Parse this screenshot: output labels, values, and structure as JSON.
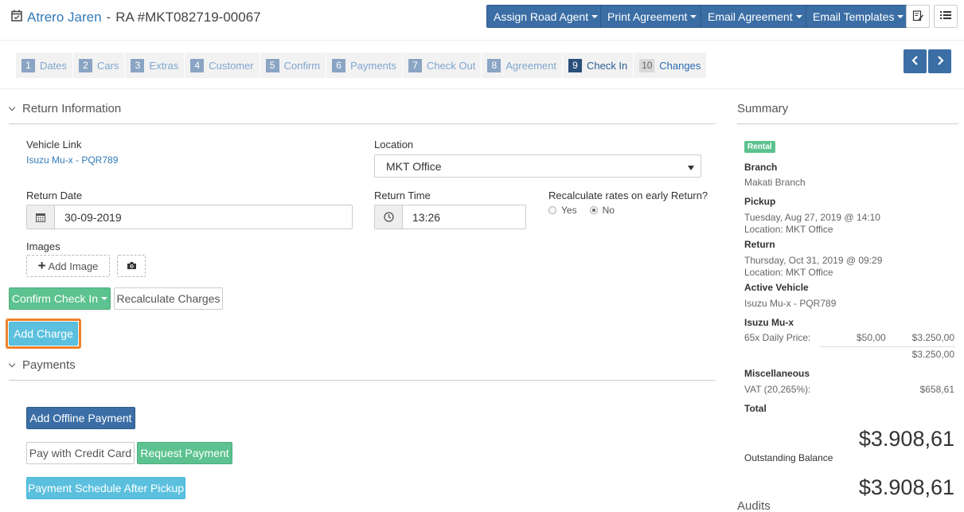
{
  "header": {
    "customer_name": "Atrero Jaren",
    "separator": "-",
    "ra_number": "RA #MKT082719-00067",
    "buttons": [
      "Assign Road Agent",
      "Print Agreement",
      "Email Agreement",
      "Email Templates"
    ]
  },
  "steps": [
    {
      "num": "1",
      "label": "Dates"
    },
    {
      "num": "2",
      "label": "Cars"
    },
    {
      "num": "3",
      "label": "Extras"
    },
    {
      "num": "4",
      "label": "Customer"
    },
    {
      "num": "5",
      "label": "Confirm"
    },
    {
      "num": "6",
      "label": "Payments"
    },
    {
      "num": "7",
      "label": "Check Out"
    },
    {
      "num": "8",
      "label": "Agreement"
    },
    {
      "num": "9",
      "label": "Check In"
    },
    {
      "num": "10",
      "label": "Changes"
    }
  ],
  "return_info": {
    "title": "Return Information",
    "vehicle_link_label": "Vehicle Link",
    "vehicle_link": "Isuzu Mu-x - PQR789",
    "location_label": "Location",
    "location_value": "MKT Office",
    "return_date_label": "Return Date",
    "return_date": "30-09-2019",
    "return_time_label": "Return Time",
    "return_time": "13:26",
    "recalc_label": "Recalculate rates on early Return?",
    "yes_label": "Yes",
    "no_label": "No",
    "images_label": "Images",
    "add_image_label": "Add Image",
    "confirm_checkin_label": "Confirm Check In",
    "recalc_charges_label": "Recalculate Charges",
    "add_charge_label": "Add Charge"
  },
  "payments": {
    "title": "Payments",
    "add_offline_label": "Add Offline Payment",
    "pay_cc_label": "Pay with Credit Card",
    "request_label": "Request Payment",
    "schedule_label": "Payment Schedule After Pickup"
  },
  "summary": {
    "title": "Summary",
    "badge": "Rental",
    "branch_label": "Branch",
    "branch": "Makati Branch",
    "pickup_label": "Pickup",
    "pickup_date": "Tuesday, Aug 27, 2019 @ 14:10",
    "pickup_location": "Location: MKT Office",
    "return_label": "Return",
    "return_date": "Thursday, Oct 31, 2019 @ 09:29",
    "return_location": "Location: MKT Office",
    "active_vehicle_label": "Active Vehicle",
    "active_vehicle": "Isuzu Mu-x - PQR789",
    "vehicle_name": "Isuzu Mu-x",
    "daily_label": "65x Daily Price:",
    "daily_rate": "$50,00",
    "daily_total": "$3.250,00",
    "vehicle_subtotal": "$3.250,00",
    "misc_label": "Miscellaneous",
    "vat_label": "VAT (20,265%):",
    "vat_value": "$658,61",
    "total_label": "Total",
    "total_value": "$3.908,61",
    "outstanding_label": "Outstanding Balance",
    "outstanding_value": "$3.908,61",
    "audits_label": "Audits"
  }
}
